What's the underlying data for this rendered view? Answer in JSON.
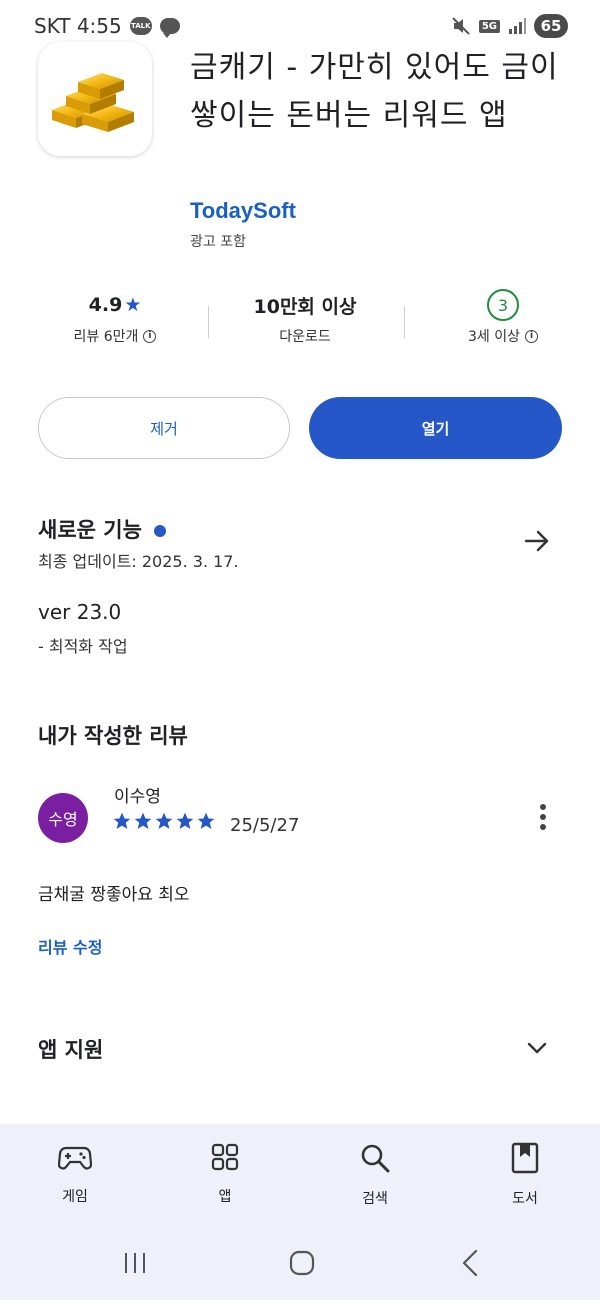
{
  "status_bar": {
    "carrier_time": "SKT 4:55",
    "talk_badge": "TALK",
    "network": "5G",
    "battery": "65",
    "icons": [
      "kakaotalk-icon",
      "chat-bubble-icon",
      "mute-icon",
      "signal-icon"
    ]
  },
  "app": {
    "icon": "gold-bars-icon",
    "title": "금캐기 - 가만히 있어도 금이 쌓이는 돈버는 리워드 앱",
    "developer": "TodaySoft",
    "ad_note": "광고 포함"
  },
  "stats": {
    "rating_value": "4.9",
    "rating_star": "★",
    "rating_label": "리뷰 6만개",
    "downloads_value": "10만회 이상",
    "downloads_label": "다운로드",
    "age_value": "3",
    "age_label": "3세 이상"
  },
  "actions": {
    "remove_label": "제거",
    "open_label": "열기"
  },
  "whats_new": {
    "title": "새로운 기능",
    "updated": "최종 업데이트: 2025. 3. 17.",
    "version": "ver 23.0",
    "notes": "- 최적화 작업"
  },
  "my_review": {
    "title": "내가 작성한 리뷰",
    "avatar_text": "수영",
    "reviewer": "이수영",
    "stars": 5,
    "date": "25/5/27",
    "text": "금채굴 짱좋아요 최오",
    "edit_label": "리뷰 수정"
  },
  "app_support": {
    "title": "앱 지원"
  },
  "bottom_nav": {
    "items": [
      {
        "label": "게임",
        "icon": "gamepad-icon"
      },
      {
        "label": "앱",
        "icon": "apps-grid-icon"
      },
      {
        "label": "검색",
        "icon": "search-icon"
      },
      {
        "label": "도서",
        "icon": "book-icon"
      }
    ]
  },
  "colors": {
    "accent": "#2557c8",
    "link": "#1a5fc6",
    "avatar": "#7b1fa2",
    "age_rating": "#1e8e3e",
    "nav_bg": "#eef1f9"
  }
}
